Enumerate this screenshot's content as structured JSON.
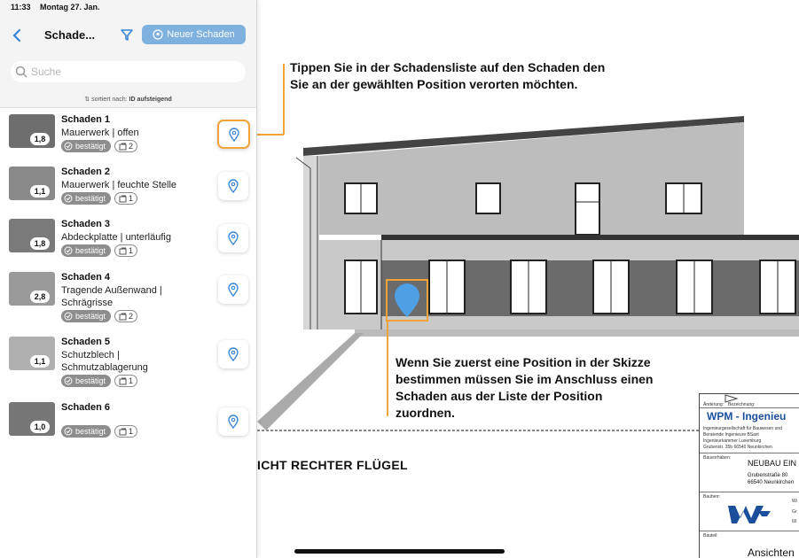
{
  "status_bar": {
    "time": "11:33",
    "date": "Montag 27. Jan."
  },
  "header": {
    "title": "Schade...",
    "new_damage_label": "Neuer Schaden"
  },
  "search": {
    "placeholder": "Suche"
  },
  "sort": {
    "prefix": "sortiert nach:",
    "value": "ID aufsteigend"
  },
  "damages": [
    {
      "title": "Schaden 1",
      "subtitle": "Mauerwerk | offen",
      "status": "bestätigt",
      "photos": "2",
      "rating": "1,8",
      "active": true
    },
    {
      "title": "Schaden 2",
      "subtitle": "Mauerwerk | feuchte Stelle",
      "status": "bestätigt",
      "photos": "1",
      "rating": "1,1",
      "active": false
    },
    {
      "title": "Schaden 3",
      "subtitle": "Abdeckplatte | unterläufig",
      "status": "bestätigt",
      "photos": "1",
      "rating": "1,8",
      "active": false
    },
    {
      "title": "Schaden 4",
      "subtitle": "Tragende Außenwand | Schrägrisse",
      "status": "bestätigt",
      "photos": "2",
      "rating": "2,8",
      "active": false
    },
    {
      "title": "Schaden 5",
      "subtitle": "Schutzblech | Schmutzablagerung",
      "status": "bestätigt",
      "photos": "1",
      "rating": "1,1",
      "active": false
    },
    {
      "title": "Schaden 6",
      "subtitle": "",
      "status": "bestätigt",
      "photos": "1",
      "rating": "1,0",
      "active": false
    }
  ],
  "callouts": {
    "top": "Tippen Sie in der Schadensliste auf den Schaden den Sie an der gewählten Position verorten möchten.",
    "bottom": "Wenn Sie zuerst eine Position in der Skizze bestimmen müssen Sie im Anschluss einen Schaden aus der Liste der Position zuordnen."
  },
  "drawing": {
    "caption": "ICHT RECHTER FLÜGEL"
  },
  "title_block": {
    "change_label": "Änderung:",
    "designation_label": "Bezeichnung:",
    "company": "WPM - Ingenieu",
    "company_line1": "Ingenieurgesellschaft für Bauwesen und",
    "company_line2": "Beratende Ingenieure BSaxt",
    "company_line3": "Ingenieurkammer Luxemburg",
    "company_line4": "Grubenstr. 35b 66540 Neunkirchen",
    "client_label": "Bauvorhaben:",
    "project": "NEUBAU EIN",
    "street": "Grubenstraße 80",
    "city": "66540 Neunkirchen",
    "builder_label": "Bauherr:",
    "builder_value_a": "Wi",
    "builder_value_b": "Gr",
    "builder_value_c": "66",
    "author_label": "Bauteil:",
    "view": "Ansichten"
  },
  "colors": {
    "accent": "#f2a33a",
    "primary": "#4a90d9",
    "pin": "#4e9fe3"
  }
}
